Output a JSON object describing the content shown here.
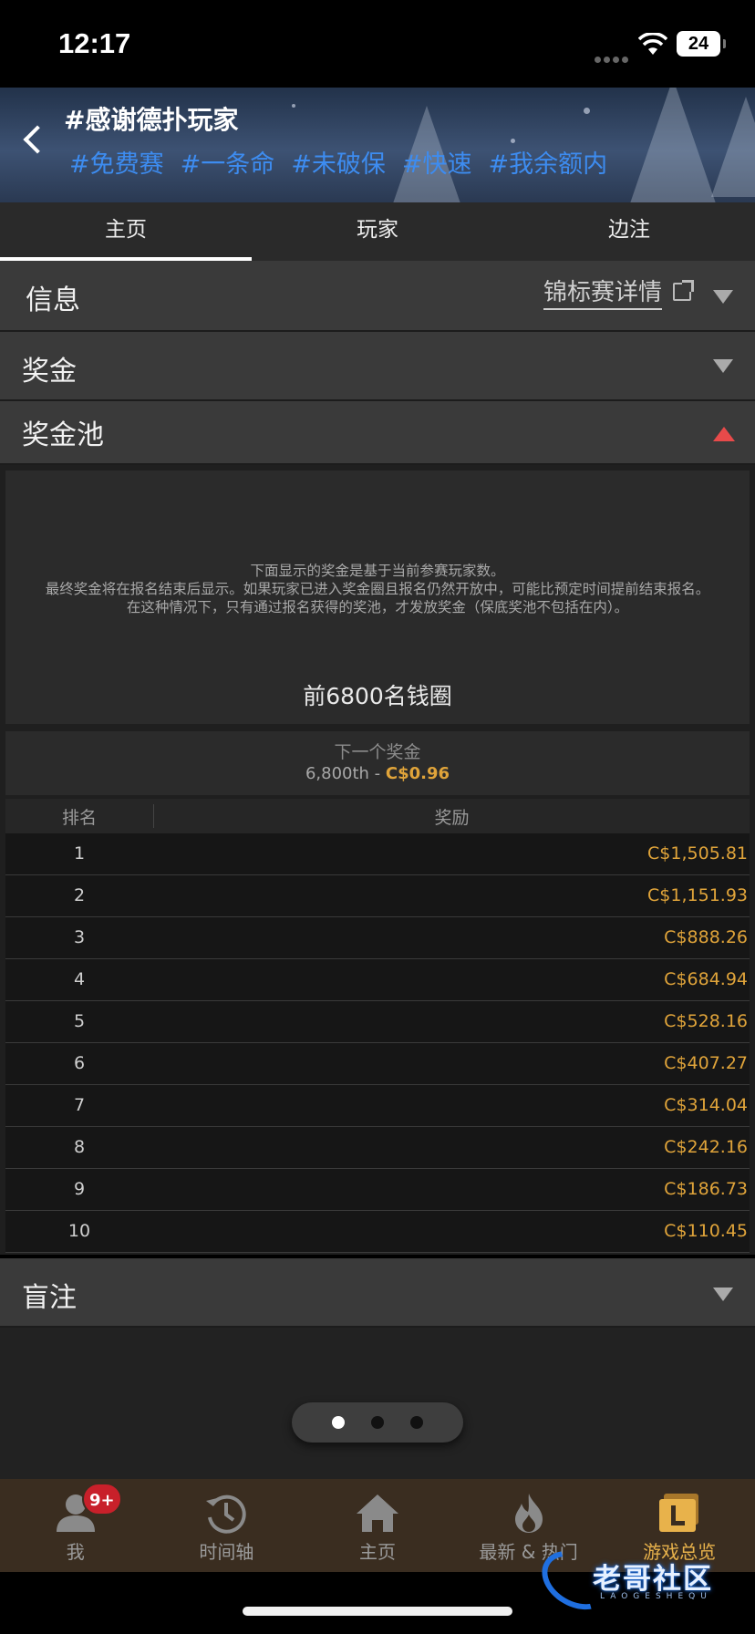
{
  "status": {
    "time": "12:17",
    "battery": "24"
  },
  "header": {
    "title": "#感谢德扑玩家",
    "tags": [
      "#免费赛",
      "#一条命",
      "#未破保",
      "#快速",
      "#我余额内"
    ]
  },
  "tabs": [
    {
      "label": "主页",
      "active": true
    },
    {
      "label": "玩家",
      "active": false
    },
    {
      "label": "边注",
      "active": false
    }
  ],
  "sections": {
    "info": {
      "title": "信息",
      "link": "锦标赛详情"
    },
    "prize": {
      "title": "奖金"
    },
    "pool": {
      "title": "奖金池"
    },
    "blinds": {
      "title": "盲注"
    }
  },
  "pool": {
    "notice": [
      "下面显示的奖金是基于当前参赛玩家数。",
      "最终奖金将在报名结束后显示。如果玩家已进入奖金圈且报名仍然开放中，可能比预定时间提前结束报名。",
      "在这种情况下，只有通过报名获得的奖池，才发放奖金（保底奖池不包括在内）。"
    ],
    "money_circle": "前6800名钱圈",
    "next_label": "下一个奖金",
    "next_rank": "6,800th - ",
    "next_amount": "C$0.96",
    "col_rank": "排名",
    "col_prize": "奖励",
    "rows": [
      {
        "rank": "1",
        "prize": "C$1,505.81"
      },
      {
        "rank": "2",
        "prize": "C$1,151.93"
      },
      {
        "rank": "3",
        "prize": "C$888.26"
      },
      {
        "rank": "4",
        "prize": "C$684.94"
      },
      {
        "rank": "5",
        "prize": "C$528.16"
      },
      {
        "rank": "6",
        "prize": "C$407.27"
      },
      {
        "rank": "7",
        "prize": "C$314.04"
      },
      {
        "rank": "8",
        "prize": "C$242.16"
      },
      {
        "rank": "9",
        "prize": "C$186.73"
      },
      {
        "rank": "10",
        "prize": "C$110.45"
      }
    ]
  },
  "bottom_nav": [
    {
      "label": "我",
      "icon": "user-icon",
      "badge": "9+"
    },
    {
      "label": "时间轴",
      "icon": "history-icon"
    },
    {
      "label": "主页",
      "icon": "home-icon"
    },
    {
      "label": "最新 & 热门",
      "icon": "fire-icon"
    },
    {
      "label": "游戏总览",
      "icon": "games-overview-icon",
      "active": true
    }
  ],
  "watermark": {
    "text": "老哥社区",
    "sub": "LAOGESHEQU"
  },
  "colors": {
    "accent_gold": "#e0a43a",
    "tag_blue": "#3d8cf0",
    "alert_red": "#e84a4a"
  }
}
